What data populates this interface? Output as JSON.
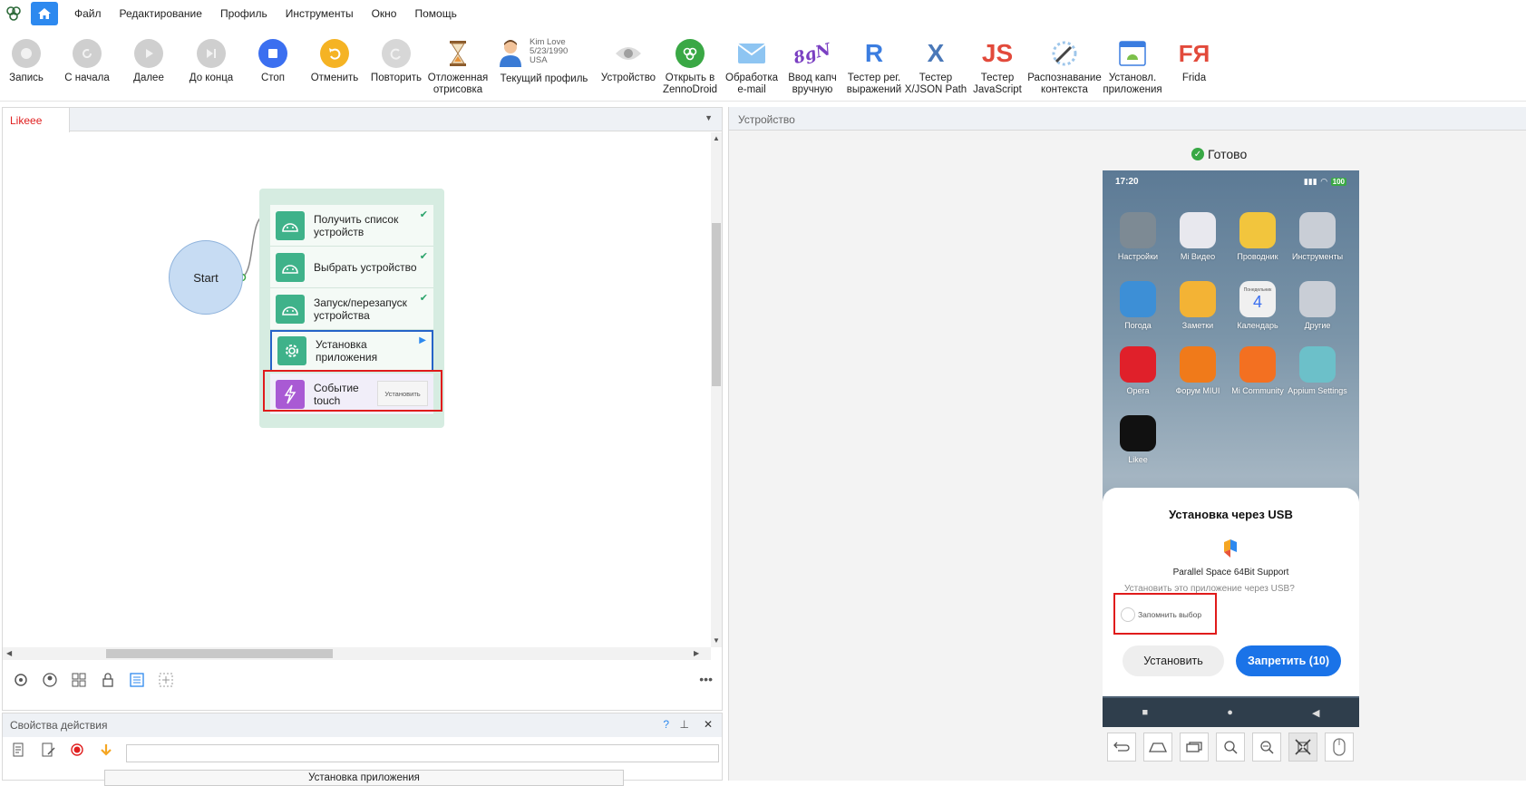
{
  "menubar": {
    "items": [
      "Файл",
      "Редактирование",
      "Профиль",
      "Инструменты",
      "Окно",
      "Помощь"
    ]
  },
  "toolbar": {
    "record": "Запись",
    "from_start": "С начала",
    "next": "Далее",
    "to_end": "До конца",
    "stop": "Стоп",
    "undo": "Отменить",
    "repeat": "Повторить",
    "delayed_l1": "Отложенная",
    "delayed_l2": "отрисовка",
    "profile_name": "Kim Love",
    "profile_date": "5/23/1990",
    "profile_country": "USA",
    "current_profile": "Текущий профиль",
    "device": "Устройство",
    "open_zd_l1": "Открыть в",
    "open_zd_l2": "ZennoDroid",
    "email_l1": "Обработка",
    "email_l2": "e-mail",
    "captcha_l1": "Ввод капч",
    "captcha_l2": "вручную",
    "regex_l1": "Тестер рег.",
    "regex_l2": "выражений",
    "xjson_l1": "Тестер",
    "xjson_l2": "X/JSON Path",
    "js_l1": "Тестер",
    "js_l2": "JavaScript",
    "context_l1": "Распознавание",
    "context_l2": "контекста",
    "installed_l1": "Установл.",
    "installed_l2": "приложения",
    "frida": "Frida",
    "captcha_icon_text": "8gN",
    "regex_icon_text": "R",
    "xjson_icon_text": "X",
    "js_icon_text": "JS",
    "frida_icon_text": "FЯ"
  },
  "left_panel": {
    "tab": "Likeee",
    "start": "Start",
    "nodes": [
      {
        "label": "Получить список устройств"
      },
      {
        "label": "Выбрать устройство"
      },
      {
        "label": "Запуск/перезапуск устройства"
      },
      {
        "label": "Установка приложения"
      },
      {
        "label": "Событие touch",
        "button": "Установить"
      }
    ]
  },
  "props": {
    "title": "Свойства действия",
    "help": "?",
    "select_value": "Установка приложения"
  },
  "right_panel": {
    "title": "Устройство",
    "status": "Готово",
    "phone": {
      "time": "17:20",
      "battery": "100",
      "apps": [
        {
          "label": "Настройки",
          "color": "#7d8a94"
        },
        {
          "label": "Mi Видео",
          "color": "#e8e8ee"
        },
        {
          "label": "Проводник",
          "color": "#f2c53d"
        },
        {
          "label": "Инструменты",
          "color": "#c9ced6"
        },
        {
          "label": "Погода",
          "color": "#3d8fd6"
        },
        {
          "label": "Заметки",
          "color": "#f3b335"
        },
        {
          "label": "Календарь",
          "color": "#f0f0f0"
        },
        {
          "label": "Другие",
          "color": "#c9ced6"
        },
        {
          "label": "Opera",
          "color": "#e0202a"
        },
        {
          "label": "Форум MIUI",
          "color": "#f07a1a"
        },
        {
          "label": "Mi Community",
          "color": "#f37021"
        },
        {
          "label": "Appium Settings",
          "color": "#6cc0c9"
        },
        {
          "label": "Likee",
          "color": "#111111"
        }
      ],
      "calendar_day": "Понедельник",
      "calendar_num": "4",
      "dialog_title": "Установка через USB",
      "dialog_app": "Parallel Space 64Bit Support",
      "dialog_question": "Установить это приложение через USB?",
      "dialog_remember": "Запомнить выбор",
      "install_btn": "Установить",
      "deny_btn": "Запретить (10)"
    }
  }
}
